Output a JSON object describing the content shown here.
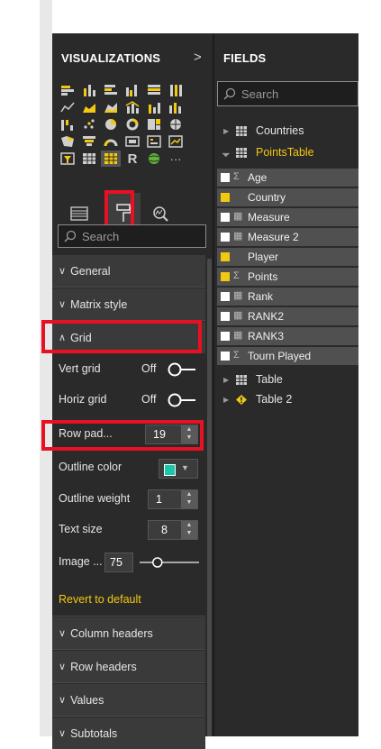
{
  "visualizations": {
    "title": "VISUALIZATIONS",
    "expand_glyph": ">",
    "search_placeholder": "Search",
    "sections": {
      "general": "General",
      "matrix_style": "Matrix style",
      "grid": "Grid",
      "column_headers": "Column headers",
      "row_headers": "Row headers",
      "values": "Values",
      "subtotals": "Subtotals"
    },
    "grid_settings": {
      "vert_grid_label": "Vert grid",
      "vert_grid_value": "Off",
      "horiz_grid_label": "Horiz grid",
      "horiz_grid_value": "Off",
      "row_padding_label": "Row pad...",
      "row_padding_value": "19",
      "outline_color_label": "Outline color",
      "outline_color": "#18c6a8",
      "outline_weight_label": "Outline weight",
      "outline_weight_value": "1",
      "text_size_label": "Text size",
      "text_size_value": "8",
      "image_label": "Image ...",
      "image_value": "75",
      "image_slider_level": 0.3
    },
    "revert_label": "Revert to default",
    "more_visuals_glyph": "···",
    "r_visual_glyph": "R"
  },
  "fields": {
    "title": "FIELDS",
    "search_placeholder": "Search",
    "tables": [
      {
        "name": "Countries",
        "expanded": false
      },
      {
        "name": "PointsTable",
        "expanded": true
      },
      {
        "name": "Table",
        "expanded": false
      },
      {
        "name": "Table 2",
        "expanded": false,
        "warning": true
      }
    ],
    "points_table_fields": [
      {
        "label": "Age",
        "checked": false,
        "type": "sigma"
      },
      {
        "label": "Country",
        "checked": true,
        "type": "none"
      },
      {
        "label": "Measure",
        "checked": false,
        "type": "calc"
      },
      {
        "label": "Measure 2",
        "checked": false,
        "type": "calc"
      },
      {
        "label": "Player",
        "checked": true,
        "type": "none"
      },
      {
        "label": "Points",
        "checked": true,
        "type": "sigma"
      },
      {
        "label": "Rank",
        "checked": false,
        "type": "calc"
      },
      {
        "label": "RANK2",
        "checked": false,
        "type": "calc"
      },
      {
        "label": "RANK3",
        "checked": false,
        "type": "calc"
      },
      {
        "label": "Tourn Played",
        "checked": false,
        "type": "sigma"
      }
    ]
  },
  "colors": {
    "highlight_red": "#e81123",
    "accent_yellow": "#f2c811",
    "panel_bg": "#2a2a2a"
  }
}
